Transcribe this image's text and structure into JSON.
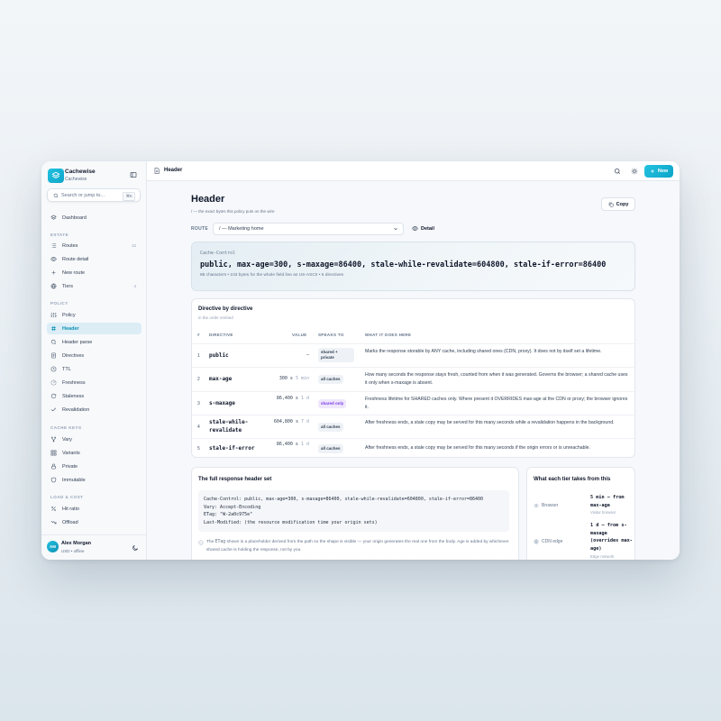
{
  "app": {
    "name": "Cachewise",
    "workspace": "Cachewise"
  },
  "search": {
    "placeholder": "Search or jump to...",
    "shortcut": "⌘K"
  },
  "sidebar": {
    "dashboard": "Dashboard",
    "sections": {
      "estate": "ESTATE",
      "policy": "POLICY",
      "cache_keys": "CACHE KEYS",
      "load_cost": "LOAD & COST"
    },
    "estate": [
      {
        "label": "Routes",
        "count": "12"
      },
      {
        "label": "Route detail"
      },
      {
        "label": "New route"
      },
      {
        "label": "Tiers",
        "count": "4"
      }
    ],
    "policy": [
      {
        "label": "Policy"
      },
      {
        "label": "Header"
      },
      {
        "label": "Header parse"
      },
      {
        "label": "Directives"
      },
      {
        "label": "TTL"
      },
      {
        "label": "Freshness"
      },
      {
        "label": "Staleness"
      },
      {
        "label": "Revalidation"
      }
    ],
    "cache_keys": [
      {
        "label": "Vary"
      },
      {
        "label": "Variants"
      },
      {
        "label": "Private"
      },
      {
        "label": "Immutable"
      }
    ],
    "load_cost": [
      {
        "label": "Hit ratio"
      },
      {
        "label": "Offload"
      }
    ]
  },
  "user": {
    "initials": "AM",
    "name": "Alex Morgan",
    "meta": "USD • offline"
  },
  "topbar": {
    "title": "Header",
    "new_label": "New"
  },
  "page": {
    "title": "Header",
    "subtitle": "/ — the exact bytes this policy puts on the wire",
    "copy_label": "Copy",
    "route_label": "ROUTE",
    "route_value": "/ — Marketing home",
    "detail_label": "Detail"
  },
  "hero": {
    "label": "Cache-Control",
    "value": "public, max-age=300, s-maxage=86400, stale-while-revalidate=604800, stale-if-error=86400",
    "meta": "88 characters • 103 bytes for the whole field line as US-ASCII • 5 directives"
  },
  "directives": {
    "title": "Directive by directive",
    "subtitle": "in the order emitted",
    "headers": [
      "#",
      "DIRECTIVE",
      "VALUE",
      "SPEAKS TO",
      "WHAT IT DOES HERE"
    ],
    "rows": [
      {
        "n": "1",
        "name": "public",
        "value": "—",
        "value_sub": "",
        "speaks": "shared + private",
        "desc": "Marks the response storable by ANY cache, including shared ones (CDN, proxy). It does not by itself set a lifetime."
      },
      {
        "n": "2",
        "name": "max-age",
        "value": "300 s",
        "value_sub": "5 min",
        "speaks": "all caches",
        "desc": "How many seconds the response stays fresh, counted from when it was generated. Governs the browser; a shared cache uses it only when s-maxage is absent."
      },
      {
        "n": "3",
        "name": "s-maxage",
        "value": "86,400 s",
        "value_sub": "1 d",
        "speaks": "shared only",
        "desc": "Freshness lifetime for SHARED caches only. Where present it OVERRIDES max-age at the CDN or proxy; the browser ignores it."
      },
      {
        "n": "4",
        "name": "stale-while-revalidate",
        "value": "604,800 s",
        "value_sub": "7 d",
        "speaks": "all caches",
        "desc": "After freshness ends, a stale copy may be served for this many seconds while a revalidation happens in the background."
      },
      {
        "n": "5",
        "name": "stale-if-error",
        "value": "86,400 s",
        "value_sub": "1 d",
        "speaks": "all caches",
        "desc": "After freshness ends, a stale copy may be served for this many seconds if the origin errors or is unreachable."
      }
    ]
  },
  "full_header": {
    "title": "The full response header set",
    "lines": [
      "Cache-Control: public, max-age=300, s-maxage=86400, stale-while-revalidate=604800, stale-if-error=86400",
      "Vary: Accept-Encoding",
      "ETag: \"W-2a0c975e\"",
      "Last-Modified: (the resource modification time your origin sets)"
    ],
    "note_pre": "The ",
    "note_code": "ETag",
    "note_post": " shown is a placeholder derived from the path so the shape is visible — your origin generates the real one from the body. Age is added by whichever shared cache is holding the response, not by you."
  },
  "tiers": {
    "title": "What each tier takes from this",
    "items": [
      {
        "name": "Browser",
        "value": "5 min — from max-age",
        "sub": "Visitor browser"
      },
      {
        "name": "CDN edge",
        "value": "1 d — from s-maxage (overrides max-age)",
        "sub": "Edge network"
      }
    ]
  },
  "colors": {
    "accent": "#0ea5c9",
    "active_bg": "#dcedf6",
    "purple": "#7c3aed"
  }
}
